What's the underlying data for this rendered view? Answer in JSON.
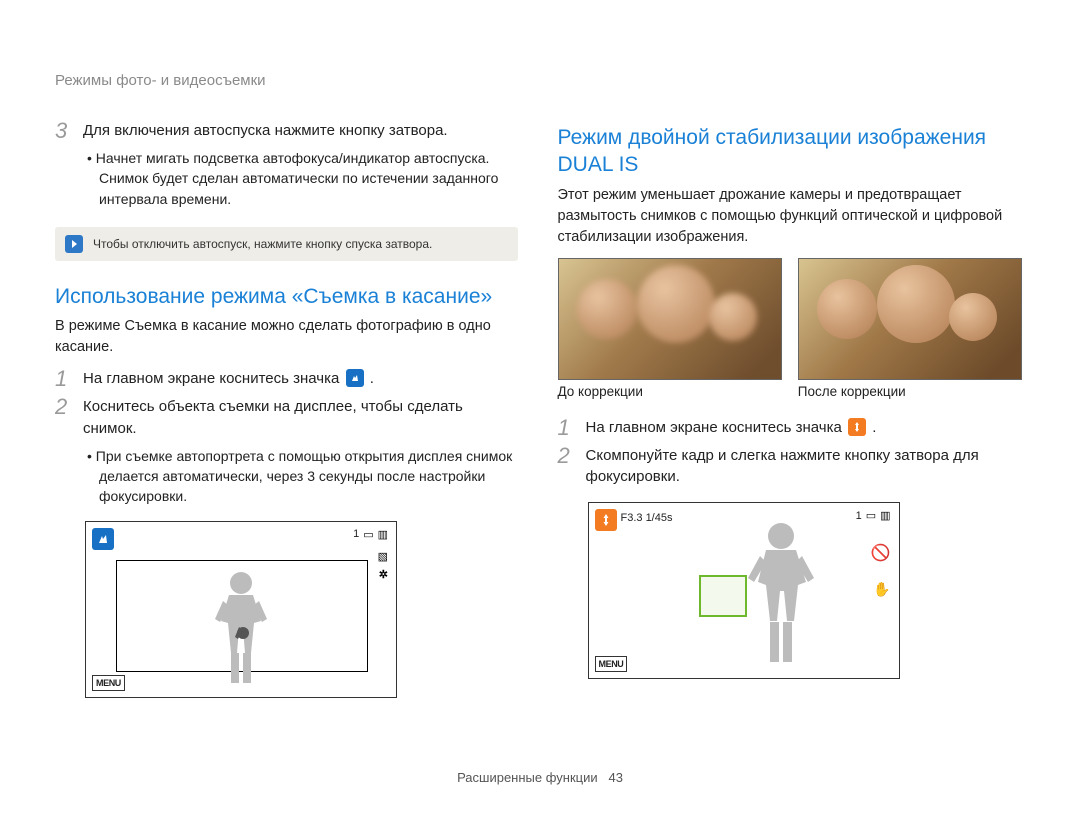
{
  "breadcrumb": "Режимы фото- и видеосъемки",
  "left": {
    "step3_num": "3",
    "step3_text": "Для включения автоспуска нажмите кнопку затвора.",
    "step3_bullet": "Начнет мигать подсветка автофокуса/индикатор автоспуска. Снимок будет сделан автоматически по истечении заданного интервала времени.",
    "note_text": "Чтобы отключить автоспуск, нажмите кнопку спуска затвора.",
    "heading": "Использование режима «Съемка в касание»",
    "intro": "В режиме Съемка в касание можно сделать фотографию в одно касание.",
    "s1_num": "1",
    "s1_text_a": "На главном экране коснитесь значка ",
    "s1_text_b": ".",
    "s2_num": "2",
    "s2_text": "Коснитесь объекта съемки на дисплее, чтобы сделать снимок.",
    "s2_bullet": "При съемке автопортрета с помощью открытия дисплея снимок делается автоматически, через 3 секунды после настройки фокусировки.",
    "lcd_count": "1",
    "menu_label": "MENU"
  },
  "right": {
    "heading": "Режим двойной стабилизации изображения DUAL IS",
    "intro": "Этот режим уменьшает дрожание камеры и предотвращает размытость снимков с помощью функций оптической и цифровой стабилизации изображения.",
    "caption_before": "До коррекции",
    "caption_after": "После коррекции",
    "s1_num": "1",
    "s1_text_a": "На главном экране коснитесь значка ",
    "s1_text_b": ".",
    "s2_num": "2",
    "s2_text": "Скомпонуйте кадр и слегка нажмите кнопку затвора для фокусировки.",
    "lcd_fvalue": "F3.3  1/45s",
    "lcd_count": "1",
    "menu_label": "MENU"
  },
  "footer_label": "Расширенные функции",
  "footer_page": "43"
}
